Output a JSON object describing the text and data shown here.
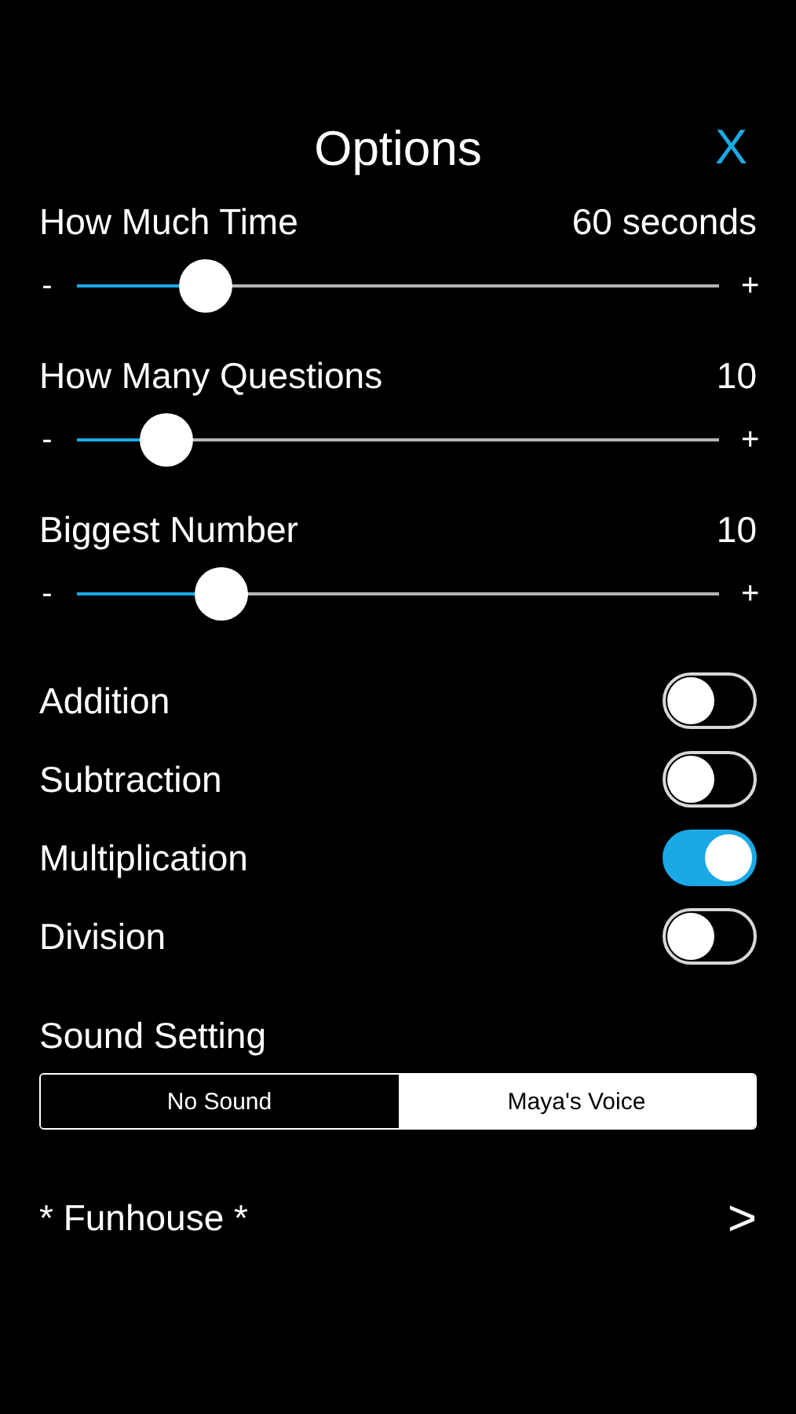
{
  "header": {
    "title": "Options",
    "close": "X"
  },
  "sliders": [
    {
      "label": "How Much Time",
      "reading": "60 seconds",
      "minus": "-",
      "plus": "+",
      "level": 0.2
    },
    {
      "label": "How Many Questions",
      "reading": "10",
      "minus": "-",
      "plus": "+",
      "level": 0.14
    },
    {
      "label": "Biggest Number",
      "reading": "10",
      "minus": "-",
      "plus": "+",
      "level": 0.225
    }
  ],
  "toggles": [
    {
      "label": "Addition",
      "on": false
    },
    {
      "label": "Subtraction",
      "on": false
    },
    {
      "label": "Multiplication",
      "on": true
    },
    {
      "label": "Division",
      "on": false
    }
  ],
  "sound": {
    "label": "Sound Setting",
    "options": [
      {
        "label": "No Sound",
        "selected": false
      },
      {
        "label": "Maya's Voice",
        "selected": true
      }
    ]
  },
  "link": {
    "label": "* Funhouse *",
    "arrow": ">"
  }
}
